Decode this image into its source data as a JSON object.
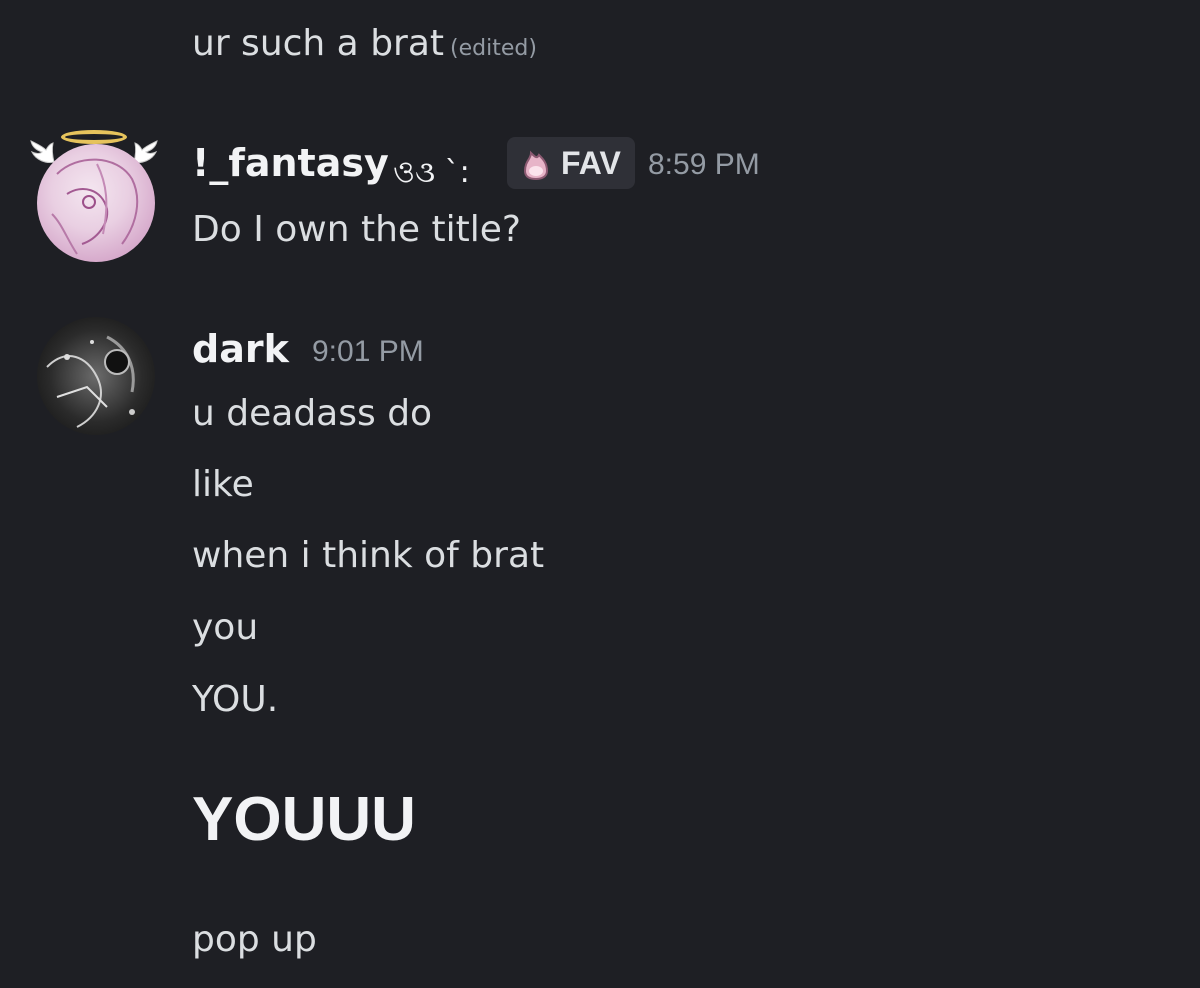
{
  "messages": {
    "first_line": {
      "text": "ur such a brat",
      "edited": "(edited)"
    },
    "fantasy": {
      "username": "!_fantasy",
      "decoration": "ও૩ `:",
      "tag_label": "FAV",
      "timestamp": "8:59 PM",
      "lines": [
        "Do I own the title?"
      ]
    },
    "dark": {
      "username": "dark",
      "timestamp": "9:01 PM",
      "lines": [
        "u deadass do",
        "like",
        "when i think of brat",
        "you",
        "YOU."
      ],
      "big_line": "YOUUU",
      "after_big": "pop up"
    }
  },
  "colors": {
    "background": "#1e1f24",
    "text": "#dbdee1",
    "muted": "#949ba4",
    "username": "#f2f3f5",
    "tag_background": "#2f3037",
    "halo": "#e6c35c"
  },
  "icons": {
    "halo": "halo-icon",
    "wings": "wing-icon",
    "tag": "pink-flame-icon"
  }
}
